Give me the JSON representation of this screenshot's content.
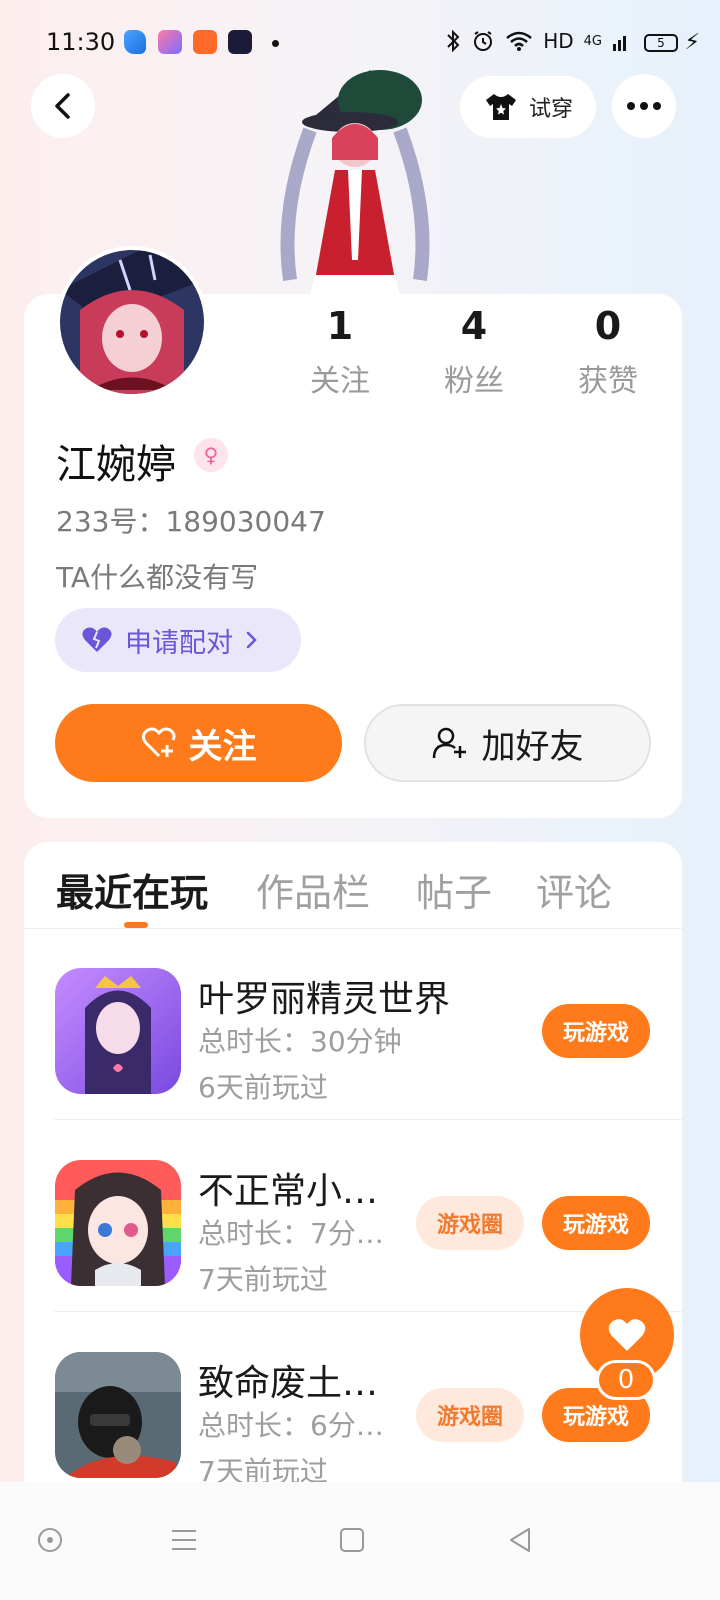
{
  "status_bar": {
    "time": "11:30",
    "network": "HD",
    "signal_type": "4G",
    "battery": "5",
    "icons": [
      "bluetooth-icon",
      "alarm-icon",
      "wifi-icon",
      "signal-icon"
    ]
  },
  "nav": {
    "back_icon": "chevron-left-icon",
    "try_on_label": "试穿",
    "more_icon": "more-icon"
  },
  "profile": {
    "stats": [
      {
        "value": "1",
        "label": "关注"
      },
      {
        "value": "4",
        "label": "粉丝"
      },
      {
        "value": "0",
        "label": "获赞"
      }
    ],
    "name": "江婉婷",
    "gender_icon": "female-icon",
    "id_line": "233号：189030047",
    "bio": "TA什么都没有写",
    "pair_label": "申请配对",
    "follow_label": "关注",
    "add_friend_label": "加好友"
  },
  "tabs": [
    {
      "label": "最近在玩",
      "active": true
    },
    {
      "label": "作品栏",
      "active": false
    },
    {
      "label": "帖子",
      "active": false
    },
    {
      "label": "评论",
      "active": false
    }
  ],
  "games": [
    {
      "title": "叶罗丽精灵世界",
      "duration": "总时长：30分钟",
      "last_played": "6天前玩过",
      "play_label": "玩游戏",
      "circle_label": null
    },
    {
      "title": "不正常小…",
      "duration": "总时长：7分…",
      "last_played": "7天前玩过",
      "play_label": "玩游戏",
      "circle_label": "游戏圈"
    },
    {
      "title": "致命废土…",
      "duration": "总时长：6分…",
      "last_played": "7天前玩过",
      "play_label": "玩游戏",
      "circle_label": "游戏圈"
    }
  ],
  "float_like": {
    "count": "0",
    "icon": "heart-icon"
  },
  "colors": {
    "accent": "#ff7a1a",
    "pair_purple": "#6b55d8"
  },
  "bottom_nav": [
    "home-circle-icon",
    "menu-icon",
    "square-icon",
    "back-triangle-icon"
  ]
}
